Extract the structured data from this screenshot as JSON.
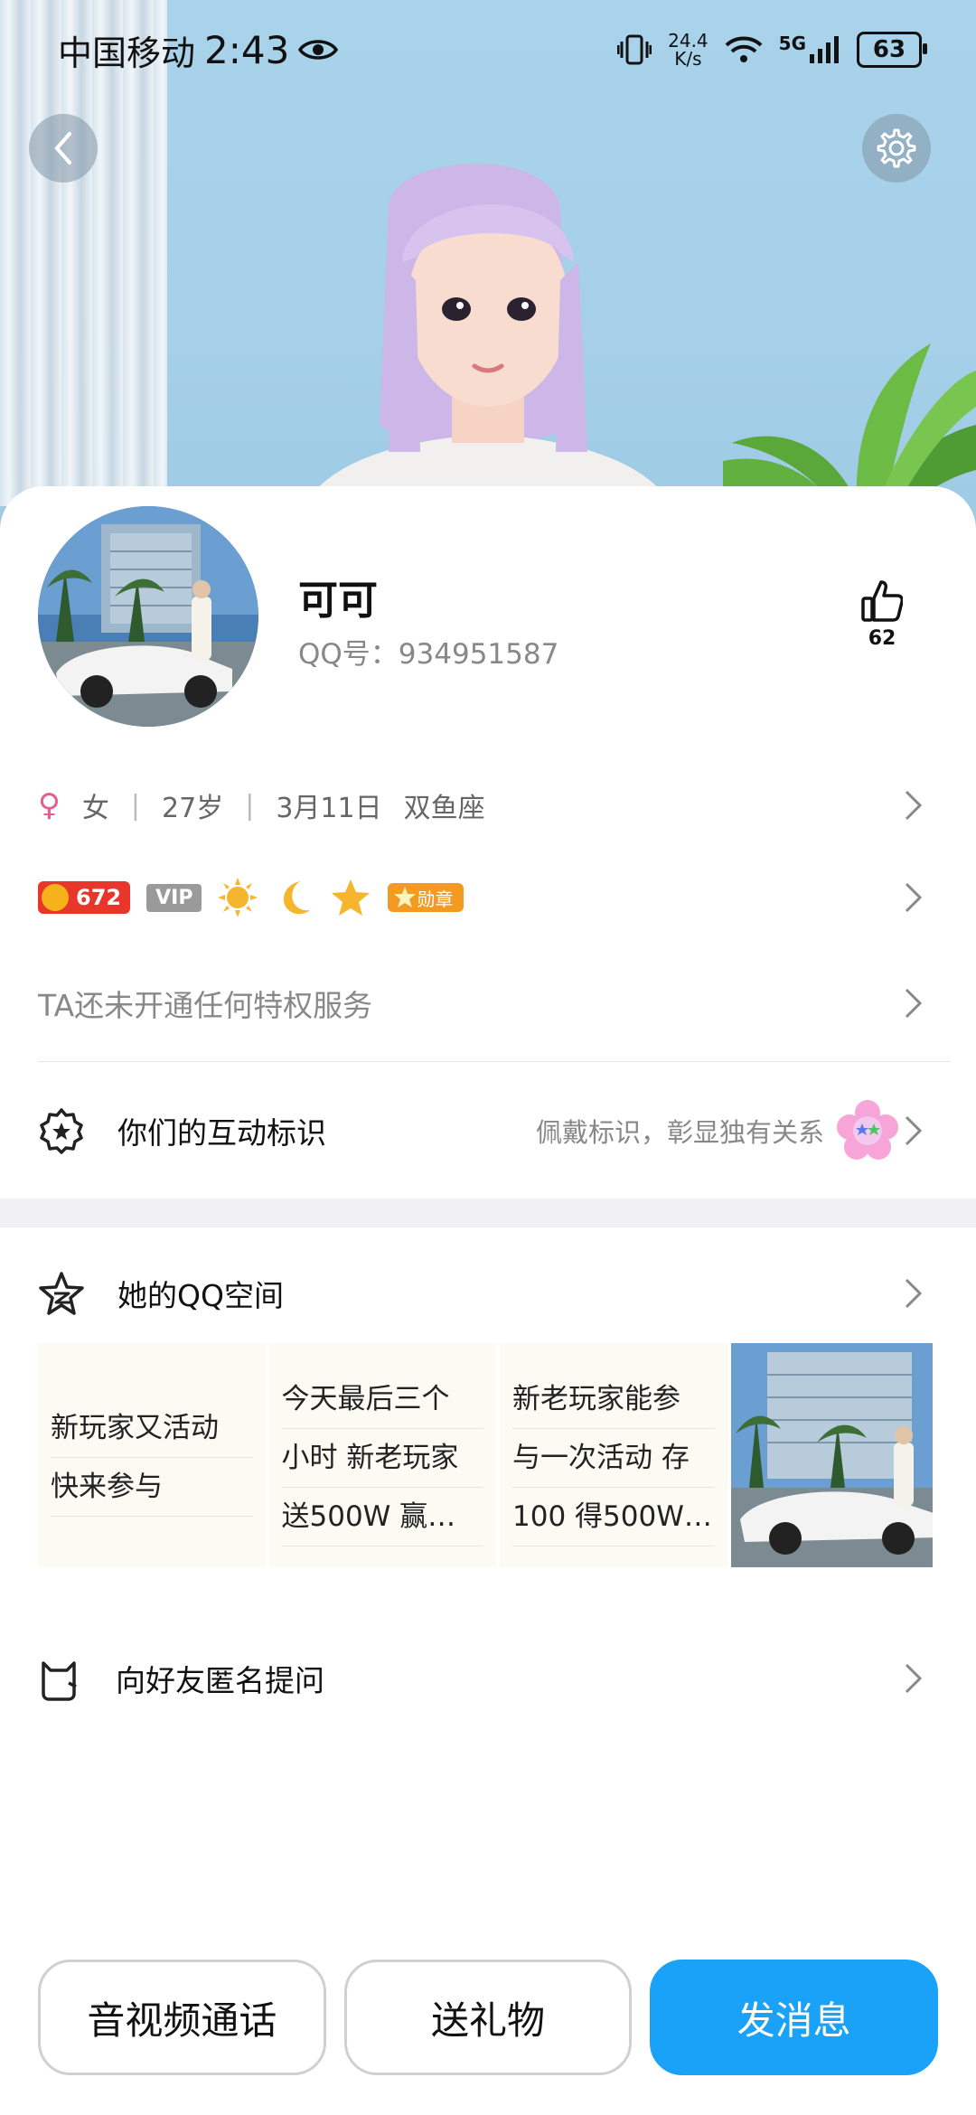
{
  "status_bar": {
    "carrier": "中国移动",
    "time": "2:43",
    "speed_value": "24.4",
    "speed_unit": "K/s",
    "network": "5G",
    "battery": "63"
  },
  "profile": {
    "name": "可可",
    "qq_id": "QQ号：934951587",
    "likes": "62",
    "gender": "女",
    "age": "27岁",
    "birthday": "3月11日",
    "zodiac": "双鱼座"
  },
  "badges": {
    "coin_value": "672",
    "vip_label": "VIP",
    "medal_label": "勋章"
  },
  "privilege_text": "TA还未开通任何特权服务",
  "interaction": {
    "label": "你们的互动标识",
    "hint": "佩戴标识，彰显独有关系"
  },
  "qzone": {
    "label": "她的QQ空间",
    "posts": [
      {
        "lines": [
          "新玩家又活动",
          "快来参与"
        ]
      },
      {
        "lines": [
          "今天最后三个",
          "小时 新老玩家",
          "送500W 赢…"
        ]
      },
      {
        "lines": [
          "新老玩家能参",
          "与一次活动 存",
          "100 得500W…"
        ]
      }
    ]
  },
  "ask": {
    "label": "向好友匿名提问"
  },
  "buttons": {
    "call": "音视频通话",
    "gift": "送礼物",
    "message": "发消息"
  },
  "colors": {
    "primary": "#1aa1f8",
    "coin": "#e8362b",
    "medal": "#f39a22"
  }
}
